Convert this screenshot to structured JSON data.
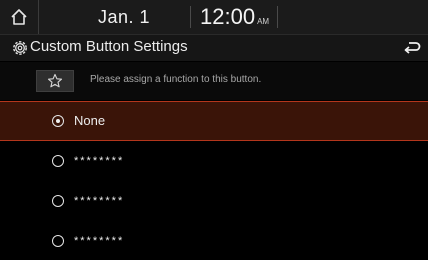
{
  "status": {
    "date": "Jan. 1",
    "time": "12:00",
    "ampm": "AM"
  },
  "header": {
    "title": "Custom Button Settings"
  },
  "info": {
    "text": "Please assign a function to this button."
  },
  "options": [
    {
      "label": "None",
      "selected": true
    },
    {
      "label": "********",
      "selected": false
    },
    {
      "label": "********",
      "selected": false
    },
    {
      "label": "********",
      "selected": false
    }
  ],
  "colors": {
    "selected_bg": "#3a1408",
    "selected_border": "#b4361c"
  }
}
